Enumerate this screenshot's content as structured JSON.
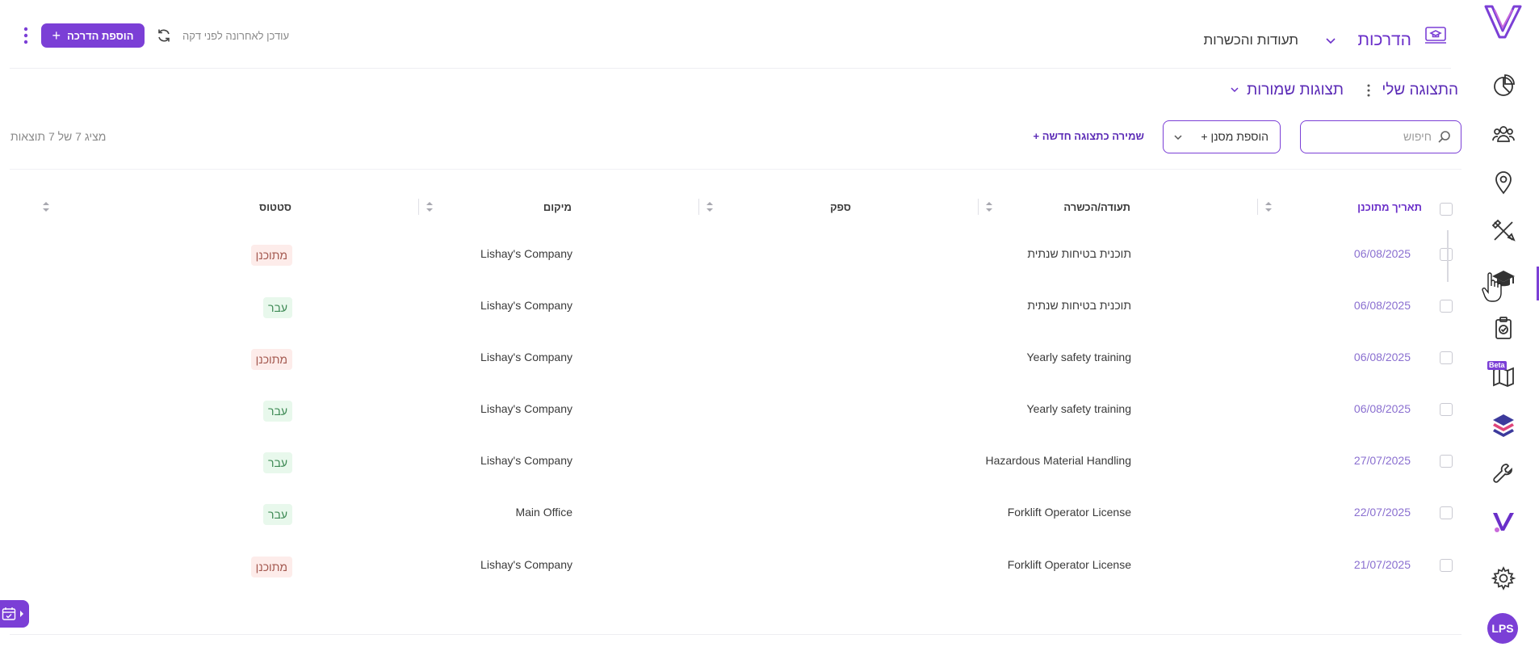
{
  "header": {
    "nav_trainings": "הדרכות",
    "nav_certifications": "תעודות והכשרות",
    "add_training_label": "הוספת הדרכה",
    "updated_text": "עודכן לאחרונה לפני דקה"
  },
  "views": {
    "my_view": "התצוגה שלי",
    "saved_views": "תצוגות שמורות"
  },
  "filters": {
    "search_placeholder": "חיפוש",
    "add_filter": "+ הוספת מסנן",
    "save_new_view": "+ שמירה כתצוגה חדשה",
    "results_text": "מציג 7 של 7 תוצאות"
  },
  "table": {
    "columns": {
      "date": "תאריך מתוכנן",
      "certificate": "תעודה/הכשרה",
      "supplier": "ספק",
      "location": "מיקום",
      "status": "סטטוס"
    },
    "rows": [
      {
        "date": "06/08/2025",
        "certificate": "תוכנית בטיחות שנתית",
        "location": "Lishay's Company",
        "status": "מתוכנן",
        "status_type": "planned"
      },
      {
        "date": "06/08/2025",
        "certificate": "תוכנית בטיחות שנתית",
        "location": "Lishay's Company",
        "status": "עבר",
        "status_type": "passed"
      },
      {
        "date": "06/08/2025",
        "certificate": "Yearly safety training",
        "location": "Lishay's Company",
        "status": "מתוכנן",
        "status_type": "planned"
      },
      {
        "date": "06/08/2025",
        "certificate": "Yearly safety training",
        "location": "Lishay's Company",
        "status": "עבר",
        "status_type": "passed"
      },
      {
        "date": "27/07/2025",
        "certificate": "Hazardous Material Handling",
        "location": "Lishay's Company",
        "status": "עבר",
        "status_type": "passed"
      },
      {
        "date": "22/07/2025",
        "certificate": "Forklift Operator License",
        "location": "Main Office",
        "status": "עבר",
        "status_type": "passed"
      },
      {
        "date": "21/07/2025",
        "certificate": "Forklift Operator License",
        "location": "Lishay's Company",
        "status": "מתוכנן",
        "status_type": "planned"
      }
    ]
  },
  "sidebar": {
    "items": [
      "dashboard-icon",
      "people-icon",
      "location-pin-icon",
      "tools-icon",
      "graduation-cap-icon",
      "clipboard-check-icon",
      "map-icon",
      "layers-icon",
      "wrench-icon",
      "brand-icon",
      "gear-icon"
    ],
    "beta_label": "Beta",
    "avatar_initials": "LPS"
  },
  "colors": {
    "accent": "#7b3fd6",
    "planned_bg": "#fdecea",
    "passed_bg": "#e8f8ec"
  }
}
